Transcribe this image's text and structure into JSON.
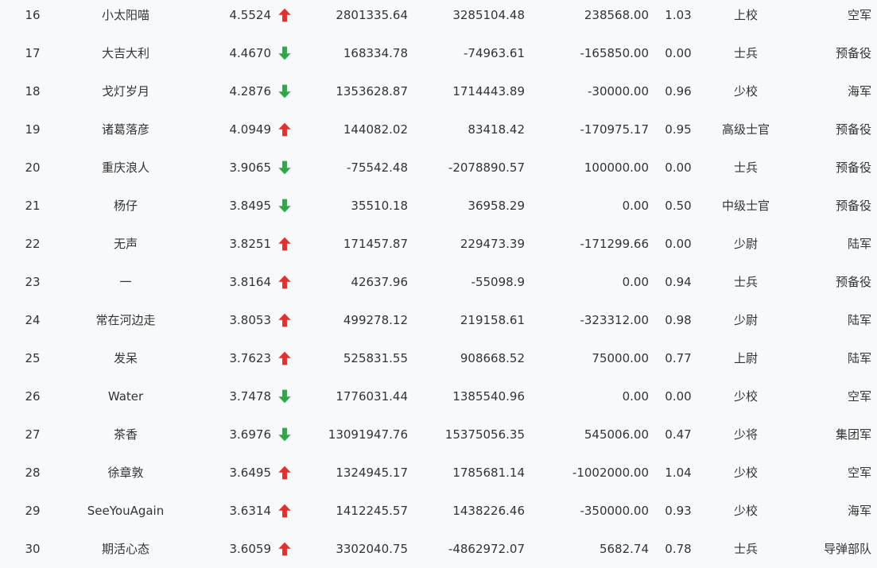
{
  "colors": {
    "up": "#e0322c",
    "down": "#2ea84a",
    "text": "#333333",
    "background": "#f8f9fb"
  },
  "rows": [
    {
      "rank": "16",
      "name": "小太阳喵",
      "score": "4.5524",
      "trend": "up",
      "v1": "2801335.64",
      "v2": "3285104.48",
      "v3": "238568.00",
      "ratio": "1.03",
      "military_rank": "上校",
      "unit": "空军"
    },
    {
      "rank": "17",
      "name": "大吉大利",
      "score": "4.4670",
      "trend": "down",
      "v1": "168334.78",
      "v2": "-74963.61",
      "v3": "-165850.00",
      "ratio": "0.00",
      "military_rank": "士兵",
      "unit": "预备役"
    },
    {
      "rank": "18",
      "name": "戈灯岁月",
      "score": "4.2876",
      "trend": "down",
      "v1": "1353628.87",
      "v2": "1714443.89",
      "v3": "-30000.00",
      "ratio": "0.96",
      "military_rank": "少校",
      "unit": "海军"
    },
    {
      "rank": "19",
      "name": "诸葛落彦",
      "score": "4.0949",
      "trend": "up",
      "v1": "144082.02",
      "v2": "83418.42",
      "v3": "-170975.17",
      "ratio": "0.95",
      "military_rank": "高级士官",
      "unit": "预备役"
    },
    {
      "rank": "20",
      "name": "重庆浪人",
      "score": "3.9065",
      "trend": "down",
      "v1": "-75542.48",
      "v2": "-2078890.57",
      "v3": "100000.00",
      "ratio": "0.00",
      "military_rank": "士兵",
      "unit": "预备役"
    },
    {
      "rank": "21",
      "name": "杨仔",
      "score": "3.8495",
      "trend": "down",
      "v1": "35510.18",
      "v2": "36958.29",
      "v3": "0.00",
      "ratio": "0.50",
      "military_rank": "中级士官",
      "unit": "预备役"
    },
    {
      "rank": "22",
      "name": "无声",
      "score": "3.8251",
      "trend": "up",
      "v1": "171457.87",
      "v2": "229473.39",
      "v3": "-171299.66",
      "ratio": "0.00",
      "military_rank": "少尉",
      "unit": "陆军"
    },
    {
      "rank": "23",
      "name": "一",
      "score": "3.8164",
      "trend": "up",
      "v1": "42637.96",
      "v2": "-55098.9",
      "v3": "0.00",
      "ratio": "0.94",
      "military_rank": "士兵",
      "unit": "预备役"
    },
    {
      "rank": "24",
      "name": "常在河边走",
      "score": "3.8053",
      "trend": "up",
      "v1": "499278.12",
      "v2": "219158.61",
      "v3": "-323312.00",
      "ratio": "0.98",
      "military_rank": "少尉",
      "unit": "陆军"
    },
    {
      "rank": "25",
      "name": "发呆",
      "score": "3.7623",
      "trend": "up",
      "v1": "525831.55",
      "v2": "908668.52",
      "v3": "75000.00",
      "ratio": "0.77",
      "military_rank": "上尉",
      "unit": "陆军"
    },
    {
      "rank": "26",
      "name": "Water",
      "score": "3.7478",
      "trend": "down",
      "v1": "1776031.44",
      "v2": "1385540.96",
      "v3": "0.00",
      "ratio": "0.00",
      "military_rank": "少校",
      "unit": "空军"
    },
    {
      "rank": "27",
      "name": "茶香",
      "score": "3.6976",
      "trend": "down",
      "v1": "13091947.76",
      "v2": "15375056.35",
      "v3": "545006.00",
      "ratio": "0.47",
      "military_rank": "少将",
      "unit": "集团军"
    },
    {
      "rank": "28",
      "name": "徐章敦",
      "score": "3.6495",
      "trend": "up",
      "v1": "1324945.17",
      "v2": "1785681.14",
      "v3": "-1002000.00",
      "ratio": "1.04",
      "military_rank": "少校",
      "unit": "空军"
    },
    {
      "rank": "29",
      "name": "SeeYouAgain",
      "score": "3.6314",
      "trend": "up",
      "v1": "1412245.57",
      "v2": "1438226.46",
      "v3": "-350000.00",
      "ratio": "0.93",
      "military_rank": "少校",
      "unit": "海军"
    },
    {
      "rank": "30",
      "name": "期活心态",
      "score": "3.6059",
      "trend": "up",
      "v1": "3302040.75",
      "v2": "-4862972.07",
      "v3": "5682.74",
      "ratio": "0.78",
      "military_rank": "士兵",
      "unit": "导弹部队"
    }
  ]
}
